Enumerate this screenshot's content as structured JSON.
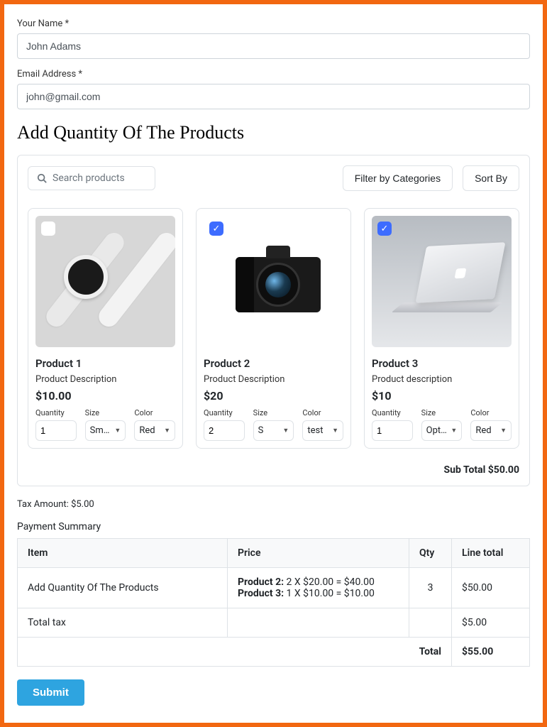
{
  "form": {
    "name_label": "Your Name *",
    "name_value": "John Adams",
    "email_label": "Email Address *",
    "email_value": "john@gmail.com"
  },
  "section_title": "Add Quantity Of The Products",
  "toolbar": {
    "search_placeholder": "Search products",
    "filter_label": "Filter by Categories",
    "sort_label": "Sort By"
  },
  "labels": {
    "quantity": "Quantity",
    "size": "Size",
    "color": "Color"
  },
  "products": [
    {
      "checked": false,
      "name": "Product 1",
      "description": "Product Description",
      "price": "$10.00",
      "quantity": "1",
      "size": "Small",
      "color": "Red"
    },
    {
      "checked": true,
      "name": "Product 2",
      "description": "Product Description",
      "price": "$20",
      "quantity": "2",
      "size": "S",
      "color": "test"
    },
    {
      "checked": true,
      "name": "Product 3",
      "description": "Product description",
      "price": "$10",
      "quantity": "1",
      "size": "Option",
      "color": "Red"
    }
  ],
  "subtotal_label": "Sub Total",
  "subtotal_value": "$50.00",
  "tax_label": "Tax Amount:",
  "tax_value": "$5.00",
  "summary_title": "Payment Summary",
  "summary_headers": {
    "item": "Item",
    "price": "Price",
    "qty": "Qty",
    "line_total": "Line total"
  },
  "summary_rows": [
    {
      "item": "Add Quantity Of The Products",
      "price_lines": [
        {
          "bold": "Product 2:",
          "rest": " 2 X $20.00 = $40.00"
        },
        {
          "bold": "Product 3:",
          "rest": " 1 X $10.00 = $10.00"
        }
      ],
      "qty": "3",
      "line_total": "$50.00"
    },
    {
      "item": "Total tax",
      "price_lines": [],
      "qty": "",
      "line_total": "$5.00"
    }
  ],
  "total_label": "Total",
  "total_value": "$55.00",
  "submit_label": "Submit"
}
